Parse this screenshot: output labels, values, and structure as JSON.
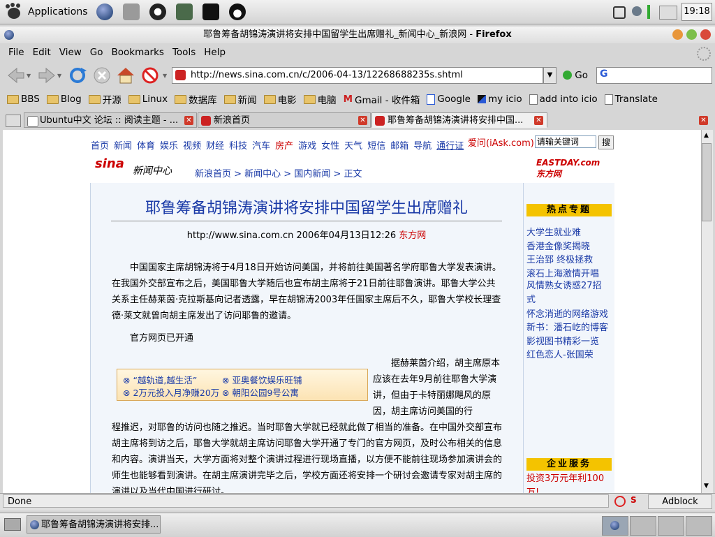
{
  "top_panel": {
    "applications_label": "Applications",
    "clock": "19:18"
  },
  "window": {
    "title_pre": "耶鲁筹备胡锦涛演讲将安排中国留学生出席赠礼_新闻中心_新浪网 - ",
    "title_app": "Firefox"
  },
  "menubar": [
    "File",
    "Edit",
    "View",
    "Go",
    "Bookmarks",
    "Tools",
    "Help"
  ],
  "navbar": {
    "url": "http://news.sina.com.cn/c/2006-04-13/12268688235s.shtml",
    "go_label": "Go",
    "search_placeholder": "G"
  },
  "bookmarks": [
    {
      "label": "BBS",
      "icon": "folder-icon"
    },
    {
      "label": "Blog",
      "icon": "folder-icon"
    },
    {
      "label": "开源",
      "icon": "folder-icon"
    },
    {
      "label": "Linux",
      "icon": "folder-icon"
    },
    {
      "label": "数据库",
      "icon": "folder-icon"
    },
    {
      "label": "新闻",
      "icon": "folder-icon"
    },
    {
      "label": "电影",
      "icon": "folder-icon"
    },
    {
      "label": "电脑",
      "icon": "folder-icon"
    },
    {
      "label": "Gmail - 收件箱",
      "icon": "gmail-icon"
    },
    {
      "label": "Google",
      "icon": "google-icon"
    },
    {
      "label": "my icio",
      "icon": "icio-icon"
    },
    {
      "label": "add into icio",
      "icon": "page-icon"
    },
    {
      "label": "Translate",
      "icon": "page-icon"
    }
  ],
  "tabs": [
    {
      "label": "Ubuntu中文 论坛 :: 阅读主题 - ..."
    },
    {
      "label": "新浪首页"
    },
    {
      "label": "耶鲁筹备胡锦涛演讲将安排中国..."
    }
  ],
  "page": {
    "top_nav": [
      "首页",
      "新闻",
      "体育",
      "娱乐",
      "视频",
      "财经",
      "科技",
      "汽车",
      "房产",
      "游戏",
      "女性",
      "天气",
      "短信",
      "邮箱",
      "导航",
      "通行证"
    ],
    "iask_label": "爱问(iAsk.com)",
    "iask_placeholder": "请输关键词",
    "iask_button": "搜",
    "logo": "sina",
    "logo_sub": "新闻中心",
    "breadcrumb": "新浪首页 > 新闻中心 > 国内新闻 > 正文",
    "partner_logo": "EASTDAY.com 东方网",
    "headline": "耶鲁筹备胡锦涛演讲将安排中国留学生出席赠礼",
    "byline_text": "http://www.sina.com.cn 2006年04月13日12:26 ",
    "byline_source": "东方网",
    "para1": "中国国家主席胡锦涛将于4月18日开始访问美国，并将前往美国著名学府耶鲁大学发表演讲。在我国外交部宣布之后，美国耶鲁大学随后也宣布胡主席将于21日前往耶鲁演讲。耶鲁大学公共关系主任赫莱茵·克拉斯基向记者透露，早在胡锦涛2003年任国家主席后不久，耶鲁大学校长理查德·莱文就曾向胡主席发出了访问耶鲁的邀请。",
    "para2": "官方网页已开通",
    "para3_float": "据赫莱茵介绍，胡主席原本应该在去年9月前往耶鲁大学演讲，但由于卡特丽娜飓风的原因，胡主席访问美国的行",
    "para3_rest": "程推迟，对耶鲁的访问也随之推迟。当时耶鲁大学就已经就此做了相当的准备。在中国外交部宣布胡主席将到访之后，耶鲁大学就胡主席访问耶鲁大学开通了专门的官方网页，及时公布相关的信息和内容。演讲当天，大学方面将对整个演讲过程进行现场直播，以方便不能前往现场参加演讲会的师生也能够看到演讲。在胡主席演讲完毕之后，学校方面还将安排一个研讨会邀请专家对胡主席的演讲以及当代中国进行研讨。",
    "ads": [
      "“越轨道,越生活”",
      "亚奥餐饮娱乐旺铺",
      "2万元投入月净赚20万",
      "朝阳公园9号公寓"
    ],
    "sidebar_hot_title": "热点专题",
    "sidebar_hot": [
      "大学生就业难",
      "香港金像奖揭晓",
      "王治郅 终极拯救",
      "滚石上海激情开唱",
      "风情熟女诱惑27招式",
      "怀念消逝的网络游戏",
      "新书：潘石屹的博客",
      "影视图书精彩一览",
      "红色恋人-张国荣"
    ],
    "sidebar_biz_title": "企业服务",
    "sidebar_biz_link": "投资3万元年利100万!"
  },
  "statusbar": {
    "status": "Done",
    "adblock": "Adblock"
  },
  "taskbar": {
    "task_label": "耶鲁筹备胡锦涛演讲将安排..."
  }
}
